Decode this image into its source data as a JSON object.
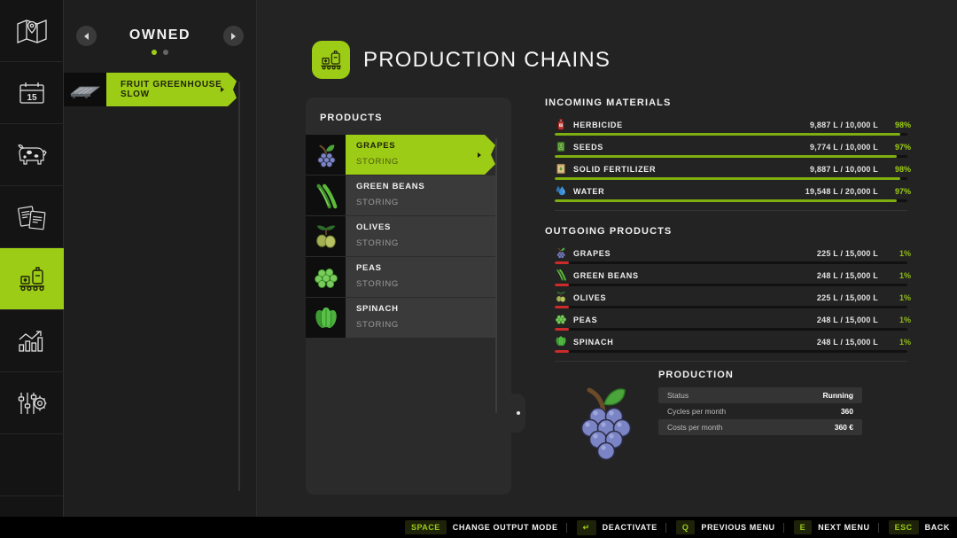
{
  "sidebar": {
    "items": [
      {
        "name": "map",
        "icon": "map-icon",
        "active": false
      },
      {
        "name": "calendar",
        "icon": "calendar-icon",
        "active": false
      },
      {
        "name": "animals",
        "icon": "cow-icon",
        "active": false
      },
      {
        "name": "contracts",
        "icon": "documents-icon",
        "active": false
      },
      {
        "name": "production",
        "icon": "factory-icon",
        "active": true
      },
      {
        "name": "statistics",
        "icon": "chart-icon",
        "active": false
      },
      {
        "name": "settings",
        "icon": "sliders-gear-icon",
        "active": false
      }
    ]
  },
  "owned": {
    "title": "OWNED",
    "prev_label": "◀",
    "next_label": "▶",
    "page_dots": 2,
    "active_dot": 0,
    "items": [
      {
        "label": "FRUIT GREENHOUSE SLOW",
        "selected": true
      }
    ]
  },
  "header": {
    "title": "PRODUCTION CHAINS",
    "icon": "factory-icon"
  },
  "products": {
    "title": "PRODUCTS",
    "items": [
      {
        "name": "GRAPES",
        "status": "STORING",
        "icon": "grapes-icon",
        "selected": true
      },
      {
        "name": "GREEN BEANS",
        "status": "STORING",
        "icon": "greenbeans-icon",
        "selected": false
      },
      {
        "name": "OLIVES",
        "status": "STORING",
        "icon": "olives-icon",
        "selected": false
      },
      {
        "name": "PEAS",
        "status": "STORING",
        "icon": "peas-icon",
        "selected": false
      },
      {
        "name": "SPINACH",
        "status": "STORING",
        "icon": "spinach-icon",
        "selected": false
      }
    ]
  },
  "incoming": {
    "title": "INCOMING MATERIALS",
    "items": [
      {
        "name": "HERBICIDE",
        "icon": "herbicide-icon",
        "amount": "9,887 L / 10,000 L",
        "percent": "98%",
        "fill": 98
      },
      {
        "name": "SEEDS",
        "icon": "seeds-icon",
        "amount": "9,774 L / 10,000 L",
        "percent": "97%",
        "fill": 97
      },
      {
        "name": "SOLID FERTILIZER",
        "icon": "fertilizer-icon",
        "amount": "9,887 L / 10,000 L",
        "percent": "98%",
        "fill": 98
      },
      {
        "name": "WATER",
        "icon": "water-icon",
        "amount": "19,548 L / 20,000 L",
        "percent": "97%",
        "fill": 97
      }
    ]
  },
  "outgoing": {
    "title": "OUTGOING PRODUCTS",
    "items": [
      {
        "name": "GRAPES",
        "icon": "grapes-icon",
        "amount": "225 L / 15,000 L",
        "percent": "1%",
        "fill": 4
      },
      {
        "name": "GREEN BEANS",
        "icon": "greenbeans-icon",
        "amount": "248 L / 15,000 L",
        "percent": "1%",
        "fill": 4
      },
      {
        "name": "OLIVES",
        "icon": "olives-icon",
        "amount": "225 L / 15,000 L",
        "percent": "1%",
        "fill": 4
      },
      {
        "name": "PEAS",
        "icon": "peas-icon",
        "amount": "248 L / 15,000 L",
        "percent": "1%",
        "fill": 4
      },
      {
        "name": "SPINACH",
        "icon": "spinach-icon",
        "amount": "248 L / 15,000 L",
        "percent": "1%",
        "fill": 4
      }
    ]
  },
  "production": {
    "title": "PRODUCTION",
    "illustration": "grapes-icon",
    "rows": [
      {
        "key": "Status",
        "value": "Running"
      },
      {
        "key": "Cycles per month",
        "value": "360"
      },
      {
        "key": "Costs per month",
        "value": "360 €"
      }
    ]
  },
  "bottom_bar": {
    "hints": [
      {
        "key": "SPACE",
        "label": "CHANGE OUTPUT MODE"
      },
      {
        "key": "↵",
        "label": "DEACTIVATE"
      },
      {
        "key": "Q",
        "label": "PREVIOUS MENU"
      },
      {
        "key": "E",
        "label": "NEXT MENU"
      },
      {
        "key": "ESC",
        "label": "BACK"
      }
    ]
  },
  "colors": {
    "accent": "#9ccc15",
    "bar_green": "#7fae10",
    "bar_red": "#cc2b2b",
    "panel": "#2b2b2b",
    "background": "#232323"
  }
}
